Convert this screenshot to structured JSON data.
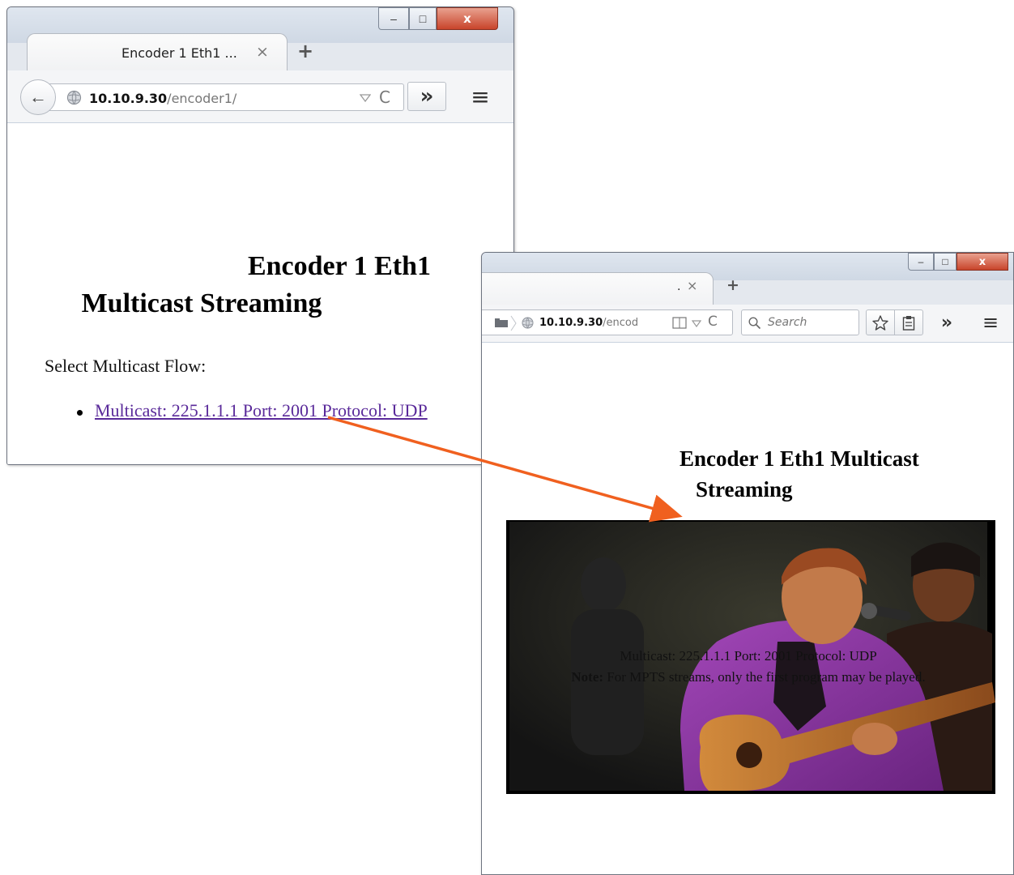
{
  "window1": {
    "tab_title": "Encoder 1 Eth1 ...",
    "tab_close": "×",
    "new_tab": "+",
    "url_host": "10.10.9.30",
    "url_path": "/encoder1/",
    "reload_glyph": "C",
    "overflow_glyph": "»",
    "menu_glyph": "≡",
    "back_glyph": "←",
    "heading_line1": "Encoder 1 Eth1",
    "heading_line2": "Multicast Streaming",
    "select_label": "Select Multicast Flow:",
    "flow_link": "Multicast: 225.1.1.1 Port: 2001 Protocol: UDP",
    "minimize_glyph": "–",
    "maximize_glyph": "□",
    "close_glyph": "x"
  },
  "window2": {
    "tab_title": ".",
    "tab_close": "×",
    "new_tab": "+",
    "url_host": "10.10.9.30",
    "url_path": "/encod",
    "search_placeholder": "Search",
    "reload_glyph": "C",
    "overflow_glyph": "»",
    "menu_glyph": "≡",
    "heading_line1": "Encoder 1 Eth1 Multicast",
    "heading_line2": "Streaming",
    "stream_caption": "Multicast: 225.1.1.1 Port: 2001 Protocol: UDP",
    "note_label": "Note:",
    "note_text": " For MPTS streams, only the first program may be played.",
    "minimize_glyph": "–",
    "maximize_glyph": "□",
    "close_glyph": "x"
  },
  "colors": {
    "link": "#5a2a9a",
    "arrow": "#f0601f",
    "window_frame": "#6e7480",
    "close_button": "#c8442b"
  },
  "icons": {
    "back": "back-arrow-icon",
    "site_info": "globe-icon",
    "reload": "reload-icon",
    "dropdown": "dropdown-triangle-icon",
    "overflow": "chevron-double-right-icon",
    "menu": "hamburger-menu-icon",
    "search": "magnifier-icon",
    "bookmark": "star-icon",
    "reading_list": "clipboard-icon",
    "reader_view": "reader-view-icon",
    "tab_list": "folder-icon"
  }
}
